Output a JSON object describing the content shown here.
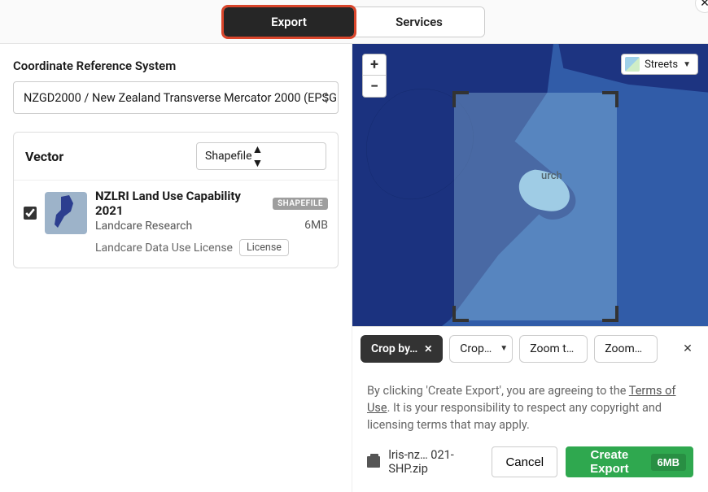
{
  "tabs": {
    "export": "Export",
    "services": "Services"
  },
  "crs": {
    "label": "Coordinate Reference System",
    "value": "NZGD2000 / New Zealand Transverse Mercator 2000 (EPSG"
  },
  "vector": {
    "title": "Vector",
    "format": "Shapefile"
  },
  "dataset": {
    "title": "NZLRI Land Use Capability 2021",
    "badge": "SHAPEFILE",
    "publisher": "Landcare Research",
    "size": "6MB",
    "license_text": "Landcare Data Use License",
    "license_pill": "License"
  },
  "map": {
    "zoom_in": "+",
    "zoom_out": "−",
    "basemap": "Streets",
    "placename": "urch"
  },
  "toolbar": {
    "crop_by": "Crop by…",
    "crop": "Crop…",
    "zoom_to": "Zoom t…",
    "zoom": "Zoom…",
    "close": "✕"
  },
  "footer": {
    "terms_pre": "By clicking 'Create Export', you are agreeing to the ",
    "terms_link": "Terms of Use",
    "terms_post": ". It is your responsibility to respect any copyright and licensing terms that may apply.",
    "zip_name": "lris-nz… 021-SHP.zip",
    "cancel": "Cancel",
    "create": "Create Export",
    "create_size": "6MB"
  }
}
